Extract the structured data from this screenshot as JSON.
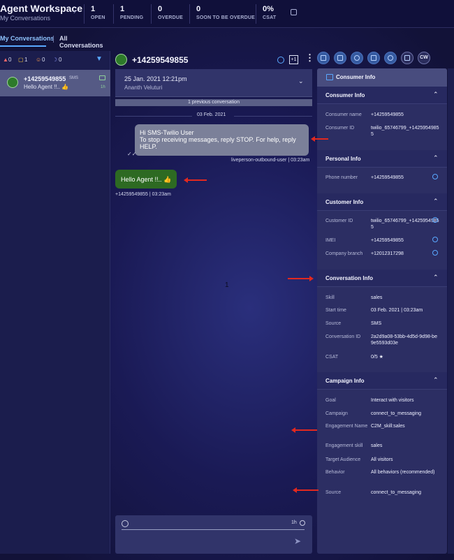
{
  "app": {
    "title": "Agent Workspace",
    "subtitle": "My Conversations",
    "stats": [
      {
        "value": "1",
        "label": "OPEN"
      },
      {
        "value": "1",
        "label": "PENDING"
      },
      {
        "value": "0",
        "label": "OVERDUE"
      },
      {
        "value": "0",
        "label": "SOON TO BE OVERDUE"
      },
      {
        "value": "0%",
        "label": "CSAT"
      }
    ]
  },
  "tabs": {
    "active": "My Conversations",
    "inactive": "All Conversations"
  },
  "filters": {
    "alerts": "0",
    "messages": "1",
    "people": "0",
    "moon": "0"
  },
  "conversation_list": [
    {
      "number": "+14259549855",
      "source": "SMS",
      "preview": "Hello Agent !!.. 👍",
      "age": "1h"
    }
  ],
  "chat": {
    "number": "+14259549855",
    "badge": "+1",
    "previous_date": "25 Jan. 2021 12:21pm",
    "previous_agent": "Ananth Veluturi",
    "previous_bar": "1 previous conversation",
    "date_separator": "03 Feb. 2021",
    "incoming": {
      "line1": "Hi SMS-Twilio User",
      "line2": "To stop receiving messages, reply STOP. For help, reply",
      "line3": "HELP.",
      "meta": "liveperson-outbound-user | 03:23am"
    },
    "outgoing": {
      "text": "Hello Agent !!.. 👍",
      "meta": "+14259549855 | 03:23am"
    },
    "center_text": "1",
    "compose_time": "1h"
  },
  "right_toolbar": {
    "cw_label": "CW"
  },
  "consumer_panel": {
    "title": "Consumer Info",
    "sections": {
      "consumer": "Consumer Info",
      "personal": "Personal Info",
      "customer": "Customer Info",
      "conversation": "Conversation Info",
      "campaign": "Campaign Info"
    },
    "consumer_rows": [
      {
        "k": "Consumer name",
        "v": "+14259549855"
      },
      {
        "k": "Consumer ID",
        "v": "twilio_65746799_+14259549855"
      }
    ],
    "personal_rows": [
      {
        "k": "Phone number",
        "v": "+14259549855"
      }
    ],
    "customer_rows": [
      {
        "k": "Customer ID",
        "v": "twilio_65746799_+14259549855"
      },
      {
        "k": "IMEI",
        "v": "+14259549855"
      },
      {
        "k": "Company branch",
        "v": "+12012317298"
      }
    ],
    "conversation_rows": [
      {
        "k": "Skill",
        "v": "sales"
      },
      {
        "k": "Start time",
        "v": "03 Feb. 2021 | 03:23am"
      },
      {
        "k": "Source",
        "v": "SMS"
      },
      {
        "k": "Conversation ID",
        "v": "2a2d9a08-53bb-4d5d-9d98-be9e5593d03e"
      },
      {
        "k": "CSAT",
        "v": "0/5 ★"
      }
    ],
    "campaign_rows": [
      {
        "k": "Goal",
        "v": "Interact with visitors"
      },
      {
        "k": "Campaign",
        "v": "connect_to_messaging"
      },
      {
        "k": "Engagement Name",
        "v": "C2M_skill:sales"
      },
      {
        "k": "Engagement skill",
        "v": "sales"
      },
      {
        "k": "Target Audience",
        "v": "All visitors"
      },
      {
        "k": "Behavior",
        "v": "All behaviors (recommended)"
      },
      {
        "k": "Source",
        "v": "connect_to_messaging"
      }
    ]
  },
  "colors": {
    "accent": "#59a8ff",
    "annotation_arrow": "#e2291f",
    "outgoing_bubble": "#2d6a22"
  }
}
